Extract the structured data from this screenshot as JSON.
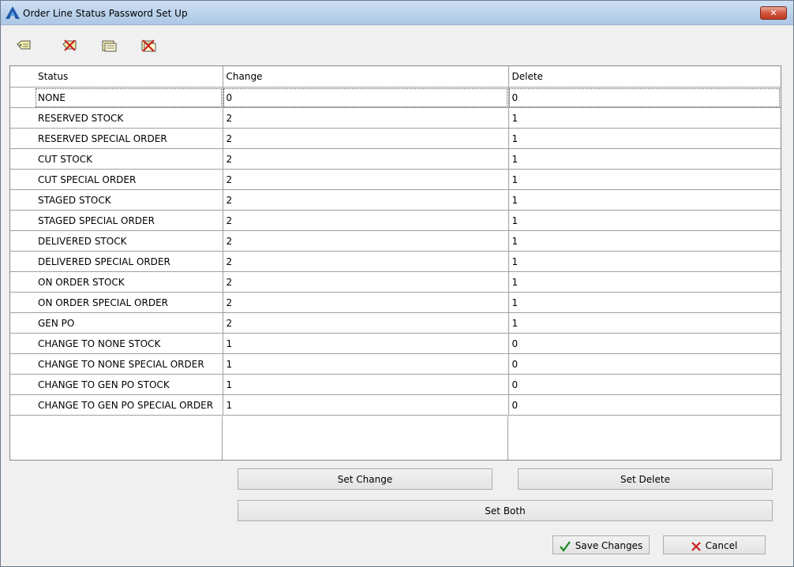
{
  "window": {
    "title": "Order Line Status Password Set Up",
    "close_label": "✕"
  },
  "toolbar": {
    "icons": [
      "add-tag-icon",
      "delete-tag-icon",
      "edit-list-icon",
      "delete-list-icon"
    ]
  },
  "grid": {
    "columns": [
      "Status",
      "Change",
      "Delete"
    ],
    "rows": [
      {
        "status": "NONE",
        "change": "0",
        "delete": "0"
      },
      {
        "status": "RESERVED STOCK",
        "change": "2",
        "delete": "1"
      },
      {
        "status": "RESERVED SPECIAL ORDER",
        "change": "2",
        "delete": "1"
      },
      {
        "status": "CUT STOCK",
        "change": "2",
        "delete": "1"
      },
      {
        "status": "CUT SPECIAL ORDER",
        "change": "2",
        "delete": "1"
      },
      {
        "status": "STAGED STOCK",
        "change": "2",
        "delete": "1"
      },
      {
        "status": "STAGED SPECIAL ORDER",
        "change": "2",
        "delete": "1"
      },
      {
        "status": "DELIVERED STOCK",
        "change": "2",
        "delete": "1"
      },
      {
        "status": "DELIVERED SPECIAL ORDER",
        "change": "2",
        "delete": "1"
      },
      {
        "status": "ON ORDER STOCK",
        "change": "2",
        "delete": "1"
      },
      {
        "status": "ON ORDER SPECIAL ORDER",
        "change": "2",
        "delete": "1"
      },
      {
        "status": "GEN PO",
        "change": "2",
        "delete": "1"
      },
      {
        "status": "CHANGE TO NONE STOCK",
        "change": "1",
        "delete": "0"
      },
      {
        "status": "CHANGE TO NONE SPECIAL ORDER",
        "change": "1",
        "delete": "0"
      },
      {
        "status": "CHANGE TO GEN PO STOCK",
        "change": "1",
        "delete": "0"
      },
      {
        "status": "CHANGE TO GEN PO SPECIAL ORDER",
        "change": "1",
        "delete": "0"
      }
    ]
  },
  "buttons": {
    "set_change": "Set Change",
    "set_delete": "Set Delete",
    "set_both": "Set Both",
    "save_changes": "Save Changes",
    "cancel": "Cancel"
  },
  "colors": {
    "titlebar": "#b9d1ea",
    "save_check": "#1a8a1a",
    "cancel_x": "#c81e1e"
  }
}
